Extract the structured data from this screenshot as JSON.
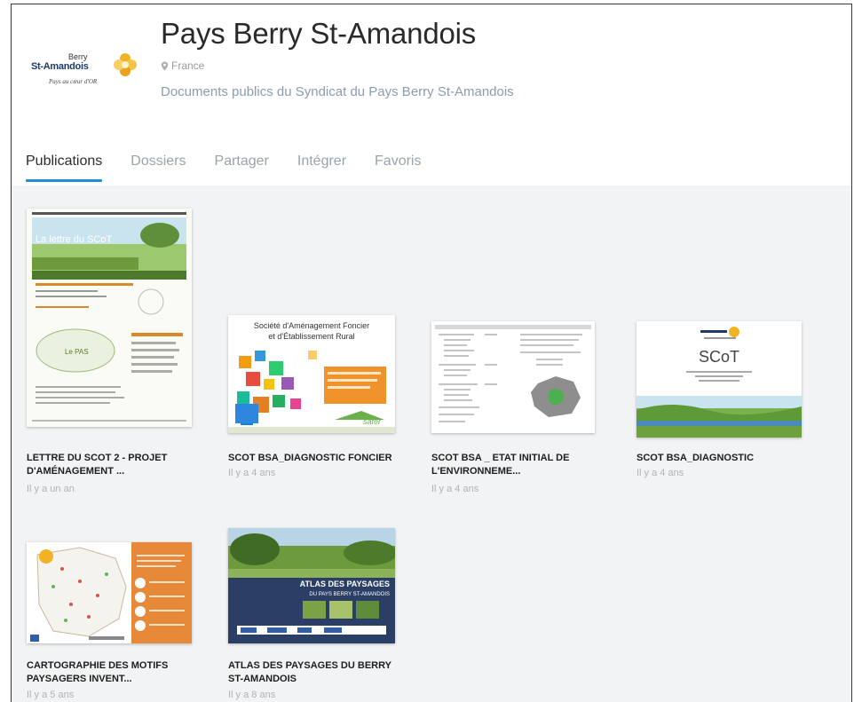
{
  "profile": {
    "logo": {
      "line1": "Berry",
      "line2": "St-Amandois",
      "tagline": "Pays au cœur d'OR"
    },
    "name": "Pays Berry St-Amandois",
    "location": "France",
    "description": "Documents publics du Syndicat du Pays Berry St-Amandois"
  },
  "tabs": [
    {
      "label": "Publications",
      "active": true
    },
    {
      "label": "Dossiers",
      "active": false
    },
    {
      "label": "Partager",
      "active": false
    },
    {
      "label": "Intégrer",
      "active": false
    },
    {
      "label": "Favoris",
      "active": false
    }
  ],
  "publications": [
    {
      "title_line1": "LETTRE DU SCOT 2 - PROJET",
      "title_line2": "D'AMÉNAGEMENT ...",
      "date": "Il y a un an",
      "cover": {
        "heading": "La lettre du SCoT",
        "sub": "Le PAS"
      }
    },
    {
      "title_line1": "SCOT BSA_DIAGNOSTIC FONCIER",
      "title_line2": "",
      "date": "Il y a 4 ans",
      "cover": {
        "heading1": "Société d'Aménagement Foncier",
        "heading2": "et d'Établissement Rural",
        "brand": "safer"
      }
    },
    {
      "title_line1": "SCOT BSA _ ETAT INITIAL DE",
      "title_line2": "L'ENVIRONNEME...",
      "date": "Il y a 4 ans"
    },
    {
      "title_line1": "SCOT BSA_DIAGNOSTIC",
      "title_line2": "",
      "date": "Il y a 4 ans",
      "cover": {
        "heading": "SCoT"
      }
    },
    {
      "title_line1": "CARTOGRAPHIE DES MOTIFS",
      "title_line2": "PAYSAGERS INVENT...",
      "date": "Il y a 5 ans"
    },
    {
      "title_line1": "ATLAS DES PAYSAGES DU BERRY",
      "title_line2": "ST-AMANDOIS",
      "date": "Il y a 8 ans",
      "cover": {
        "heading": "ATLAS DES PAYSAGES",
        "sub": "DU PAYS BERRY ST-AMANDOIS"
      }
    }
  ],
  "colors": {
    "accent": "#1f8fd0",
    "title": "#2a2a2a",
    "muted": "#9aa3ab",
    "background": "#f2f3f4"
  }
}
